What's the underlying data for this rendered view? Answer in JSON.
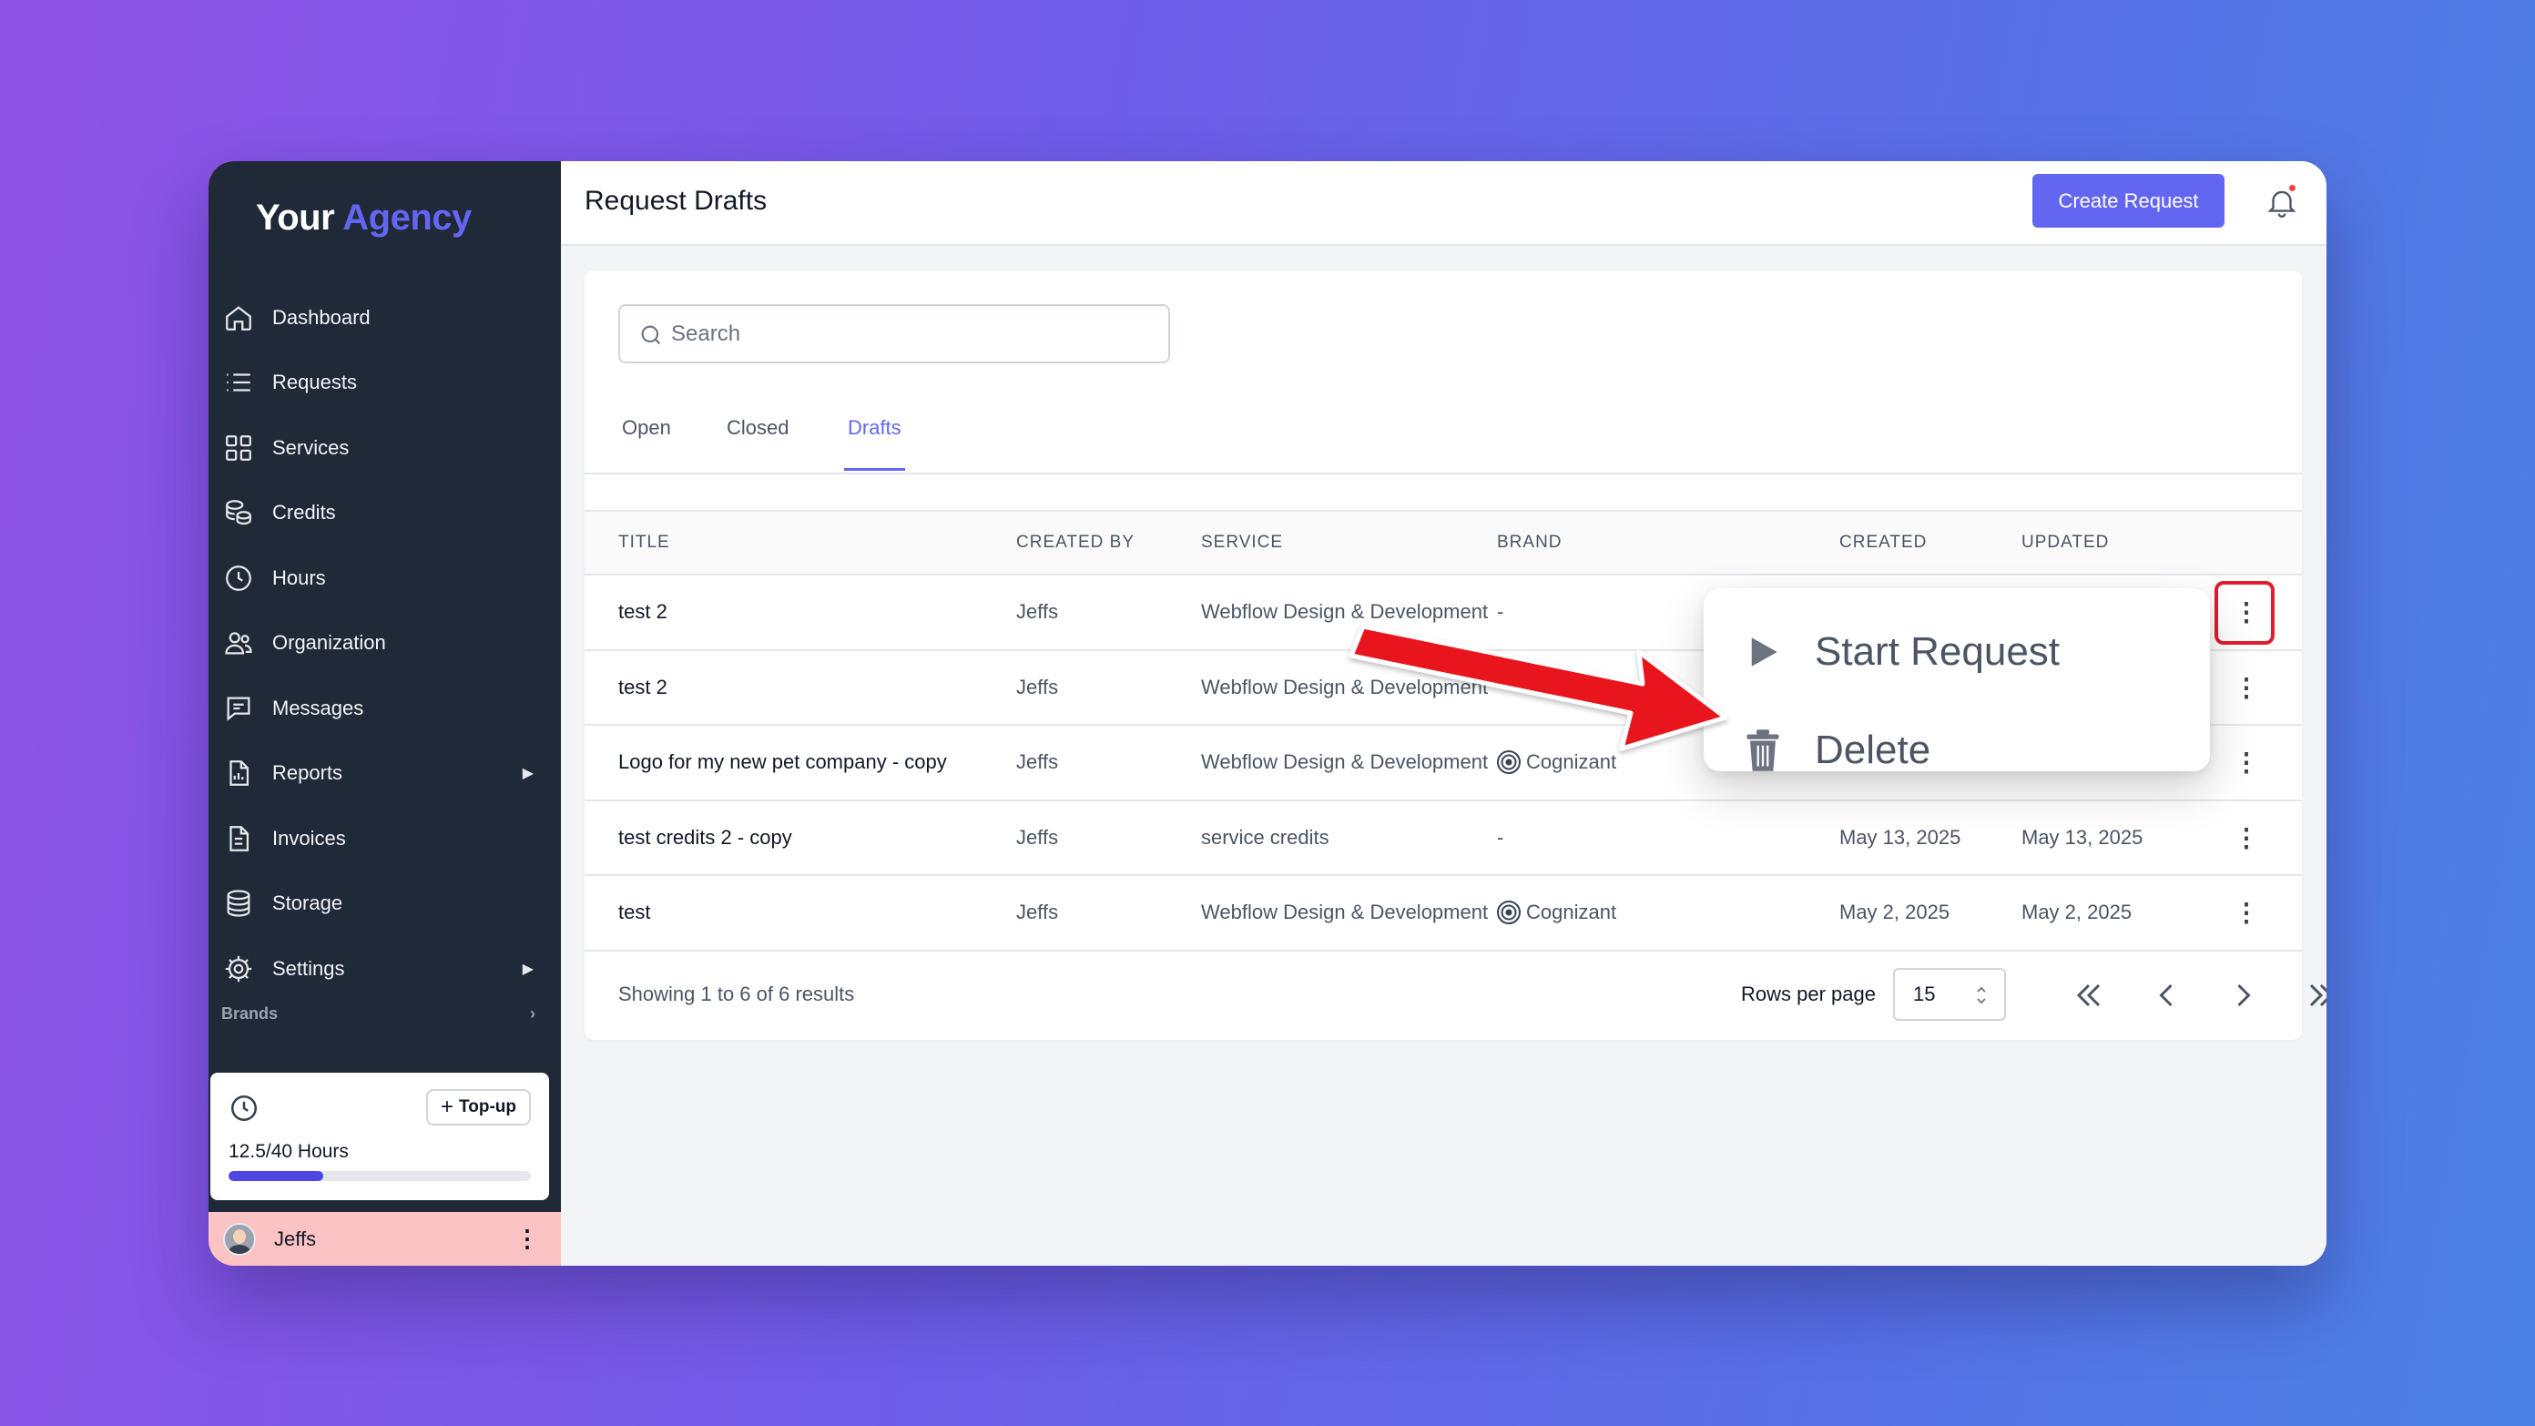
{
  "sidebar": {
    "logo_part1": "Your",
    "logo_part2": "Agency",
    "items": [
      {
        "label": "Dashboard",
        "icon": "home-icon"
      },
      {
        "label": "Requests",
        "icon": "list-icon"
      },
      {
        "label": "Services",
        "icon": "grid-icon"
      },
      {
        "label": "Credits",
        "icon": "coins-icon"
      },
      {
        "label": "Hours",
        "icon": "clock-icon"
      },
      {
        "label": "Organization",
        "icon": "users-icon"
      },
      {
        "label": "Messages",
        "icon": "message-icon"
      },
      {
        "label": "Reports",
        "icon": "report-icon",
        "caret": "▶"
      },
      {
        "label": "Invoices",
        "icon": "invoice-icon"
      },
      {
        "label": "Storage",
        "icon": "database-icon"
      },
      {
        "label": "Settings",
        "icon": "gear-icon",
        "caret": "▶"
      }
    ],
    "brands_label": "Brands",
    "brands_caret": "›",
    "hours_card": {
      "topup_plus": "+",
      "topup_label": "Top-up",
      "hours_text": "12.5/40 Hours",
      "progress_fraction": 0.3125
    },
    "user": {
      "name": "Jeffs",
      "menu": "⋮"
    }
  },
  "header": {
    "title": "Request Drafts",
    "create_button": "Create Request"
  },
  "search": {
    "placeholder": "Search"
  },
  "tabs": [
    {
      "label": "Open"
    },
    {
      "label": "Closed"
    },
    {
      "label": "Drafts",
      "active": true
    }
  ],
  "table": {
    "columns": [
      "TITLE",
      "CREATED BY",
      "SERVICE",
      "BRAND",
      "CREATED",
      "UPDATED"
    ],
    "rows": [
      {
        "title": "test 2",
        "created_by": "Jeffs",
        "service": "Webflow Design & Development",
        "brand": "-",
        "created": "",
        "updated": ""
      },
      {
        "title": "test 2",
        "created_by": "Jeffs",
        "service": "Webflow Design & Development",
        "brand": "",
        "created": "",
        "updated": ""
      },
      {
        "title": "Logo for my new pet company - copy",
        "created_by": "Jeffs",
        "service": "Webflow Design & Development",
        "brand": "Cognizant",
        "created": "",
        "updated": ""
      },
      {
        "title": "test credits 2 - copy",
        "created_by": "Jeffs",
        "service": "service credits",
        "brand": "-",
        "created": "May 13, 2025",
        "updated": "May 13, 2025"
      },
      {
        "title": "test",
        "created_by": "Jeffs",
        "service": "Webflow Design & Development",
        "brand": "Cognizant",
        "created": "May 2, 2025",
        "updated": "May 2, 2025"
      }
    ],
    "row_menu": "⋮"
  },
  "footer": {
    "showing": "Showing 1 to 6 of 6 results",
    "rows_per_page_label": "Rows per page",
    "rows_per_page_value": "15"
  },
  "menu": {
    "items": [
      {
        "label": "Start Request",
        "icon": "play-icon"
      },
      {
        "label": "Delete",
        "icon": "trash-icon"
      }
    ]
  },
  "colors": {
    "accent": "#6366f1",
    "sidebar_bg": "#1f2937",
    "annotation_red": "#e11d2e"
  }
}
